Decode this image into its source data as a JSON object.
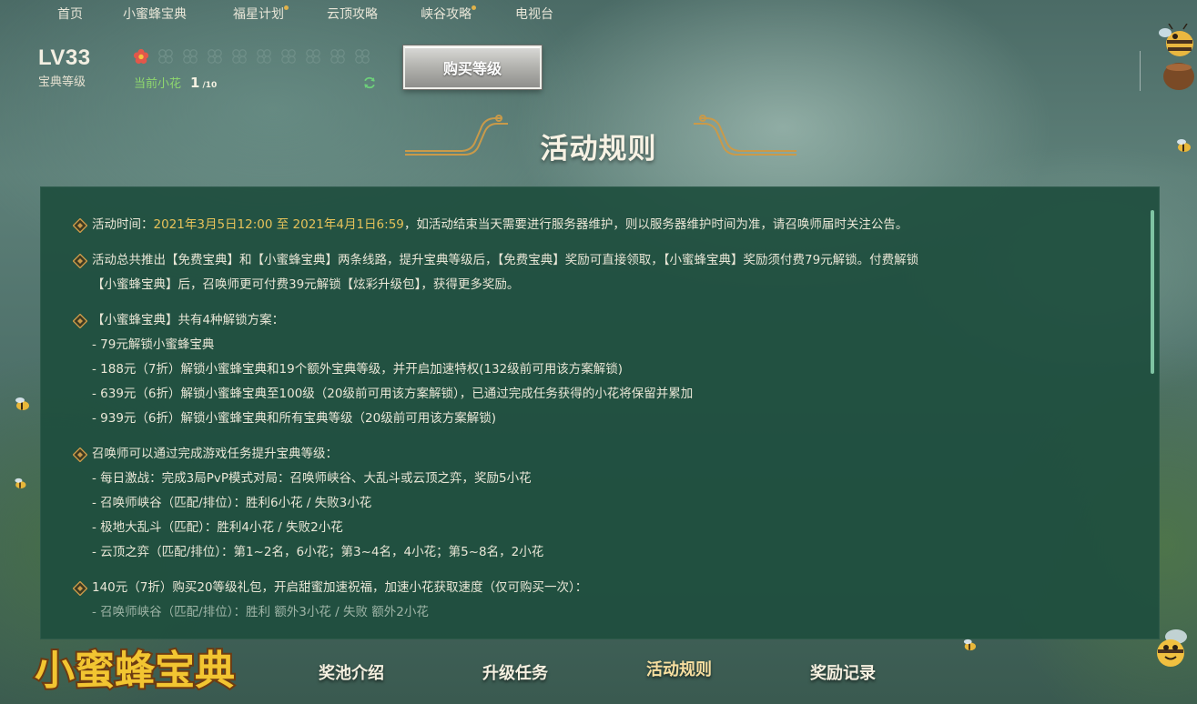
{
  "nav": {
    "items": [
      {
        "label": "首页",
        "dot": false
      },
      {
        "label": "小蜜蜂宝典",
        "dot": false
      },
      {
        "label": "福星计划",
        "dot": true
      },
      {
        "label": "云顶攻略",
        "dot": false
      },
      {
        "label": "峡谷攻略",
        "dot": true
      },
      {
        "label": "电视台",
        "dot": false
      }
    ]
  },
  "level": {
    "value": "LV33",
    "label": "宝典等级"
  },
  "flowers": {
    "label": "当前小花",
    "current": "1",
    "total": "/10",
    "filled": 1,
    "slots": 10
  },
  "buy_button": "购买等级",
  "section_title": "活动规则",
  "rules": {
    "r1_prefix": "活动时间：",
    "r1_time": "2021年3月5日12:00 至 2021年4月1日6:59",
    "r1_suffix": "，如活动结束当天需要进行服务器维护，则以服务器维护时间为准，请召唤师届时关注公告。",
    "r2_line1": "活动总共推出【免费宝典】和【小蜜蜂宝典】两条线路，提升宝典等级后，【免费宝典】奖励可直接领取，【小蜜蜂宝典】奖励须付费79元解锁。付费解锁",
    "r2_line2": "【小蜜蜂宝典】后，召唤师更可付费39元解锁【炫彩升级包】，获得更多奖励。",
    "r3_line1": "【小蜜蜂宝典】共有4种解锁方案：",
    "r3_line2": "- 79元解锁小蜜蜂宝典",
    "r3_line3": "- 188元（7折）解锁小蜜蜂宝典和19个额外宝典等级，并开启加速特权(132级前可用该方案解锁)",
    "r3_line4": "- 639元（6折）解锁小蜜蜂宝典至100级（20级前可用该方案解锁），已通过完成任务获得的小花将保留并累加",
    "r3_line5": "- 939元（6折）解锁小蜜蜂宝典和所有宝典等级（20级前可用该方案解锁)",
    "r4_line1": "召唤师可以通过完成游戏任务提升宝典等级：",
    "r4_line2": "- 每日激战：完成3局PvP模式对局：召唤师峡谷、大乱斗或云顶之弈，奖励5小花",
    "r4_line3": "- 召唤师峡谷（匹配/排位）：胜利6小花 / 失败3小花",
    "r4_line4": "- 极地大乱斗（匹配）：胜利4小花 / 失败2小花",
    "r4_line5": "- 云顶之弈（匹配/排位）：第1~2名，6小花；第3~4名，4小花；第5~8名，2小花",
    "r5_line1": "140元（7折）购买20等级礼包，开启甜蜜加速祝福，加速小花获取速度（仅可购买一次）：",
    "r5_line2": "- 召唤师峡谷（匹配/排位）：胜利 额外3小花 / 失败 额外2小花"
  },
  "logo_text": "小蜜蜂宝典",
  "tabs": [
    {
      "label": "奖池介绍",
      "active": false
    },
    {
      "label": "升级任务",
      "active": false
    },
    {
      "label": "活动规则",
      "active": true
    },
    {
      "label": "奖励记录",
      "active": false
    }
  ],
  "colors": {
    "highlight": "#e6c25a",
    "flower_label": "#8fd86e",
    "panel": "#1e4e3e"
  }
}
